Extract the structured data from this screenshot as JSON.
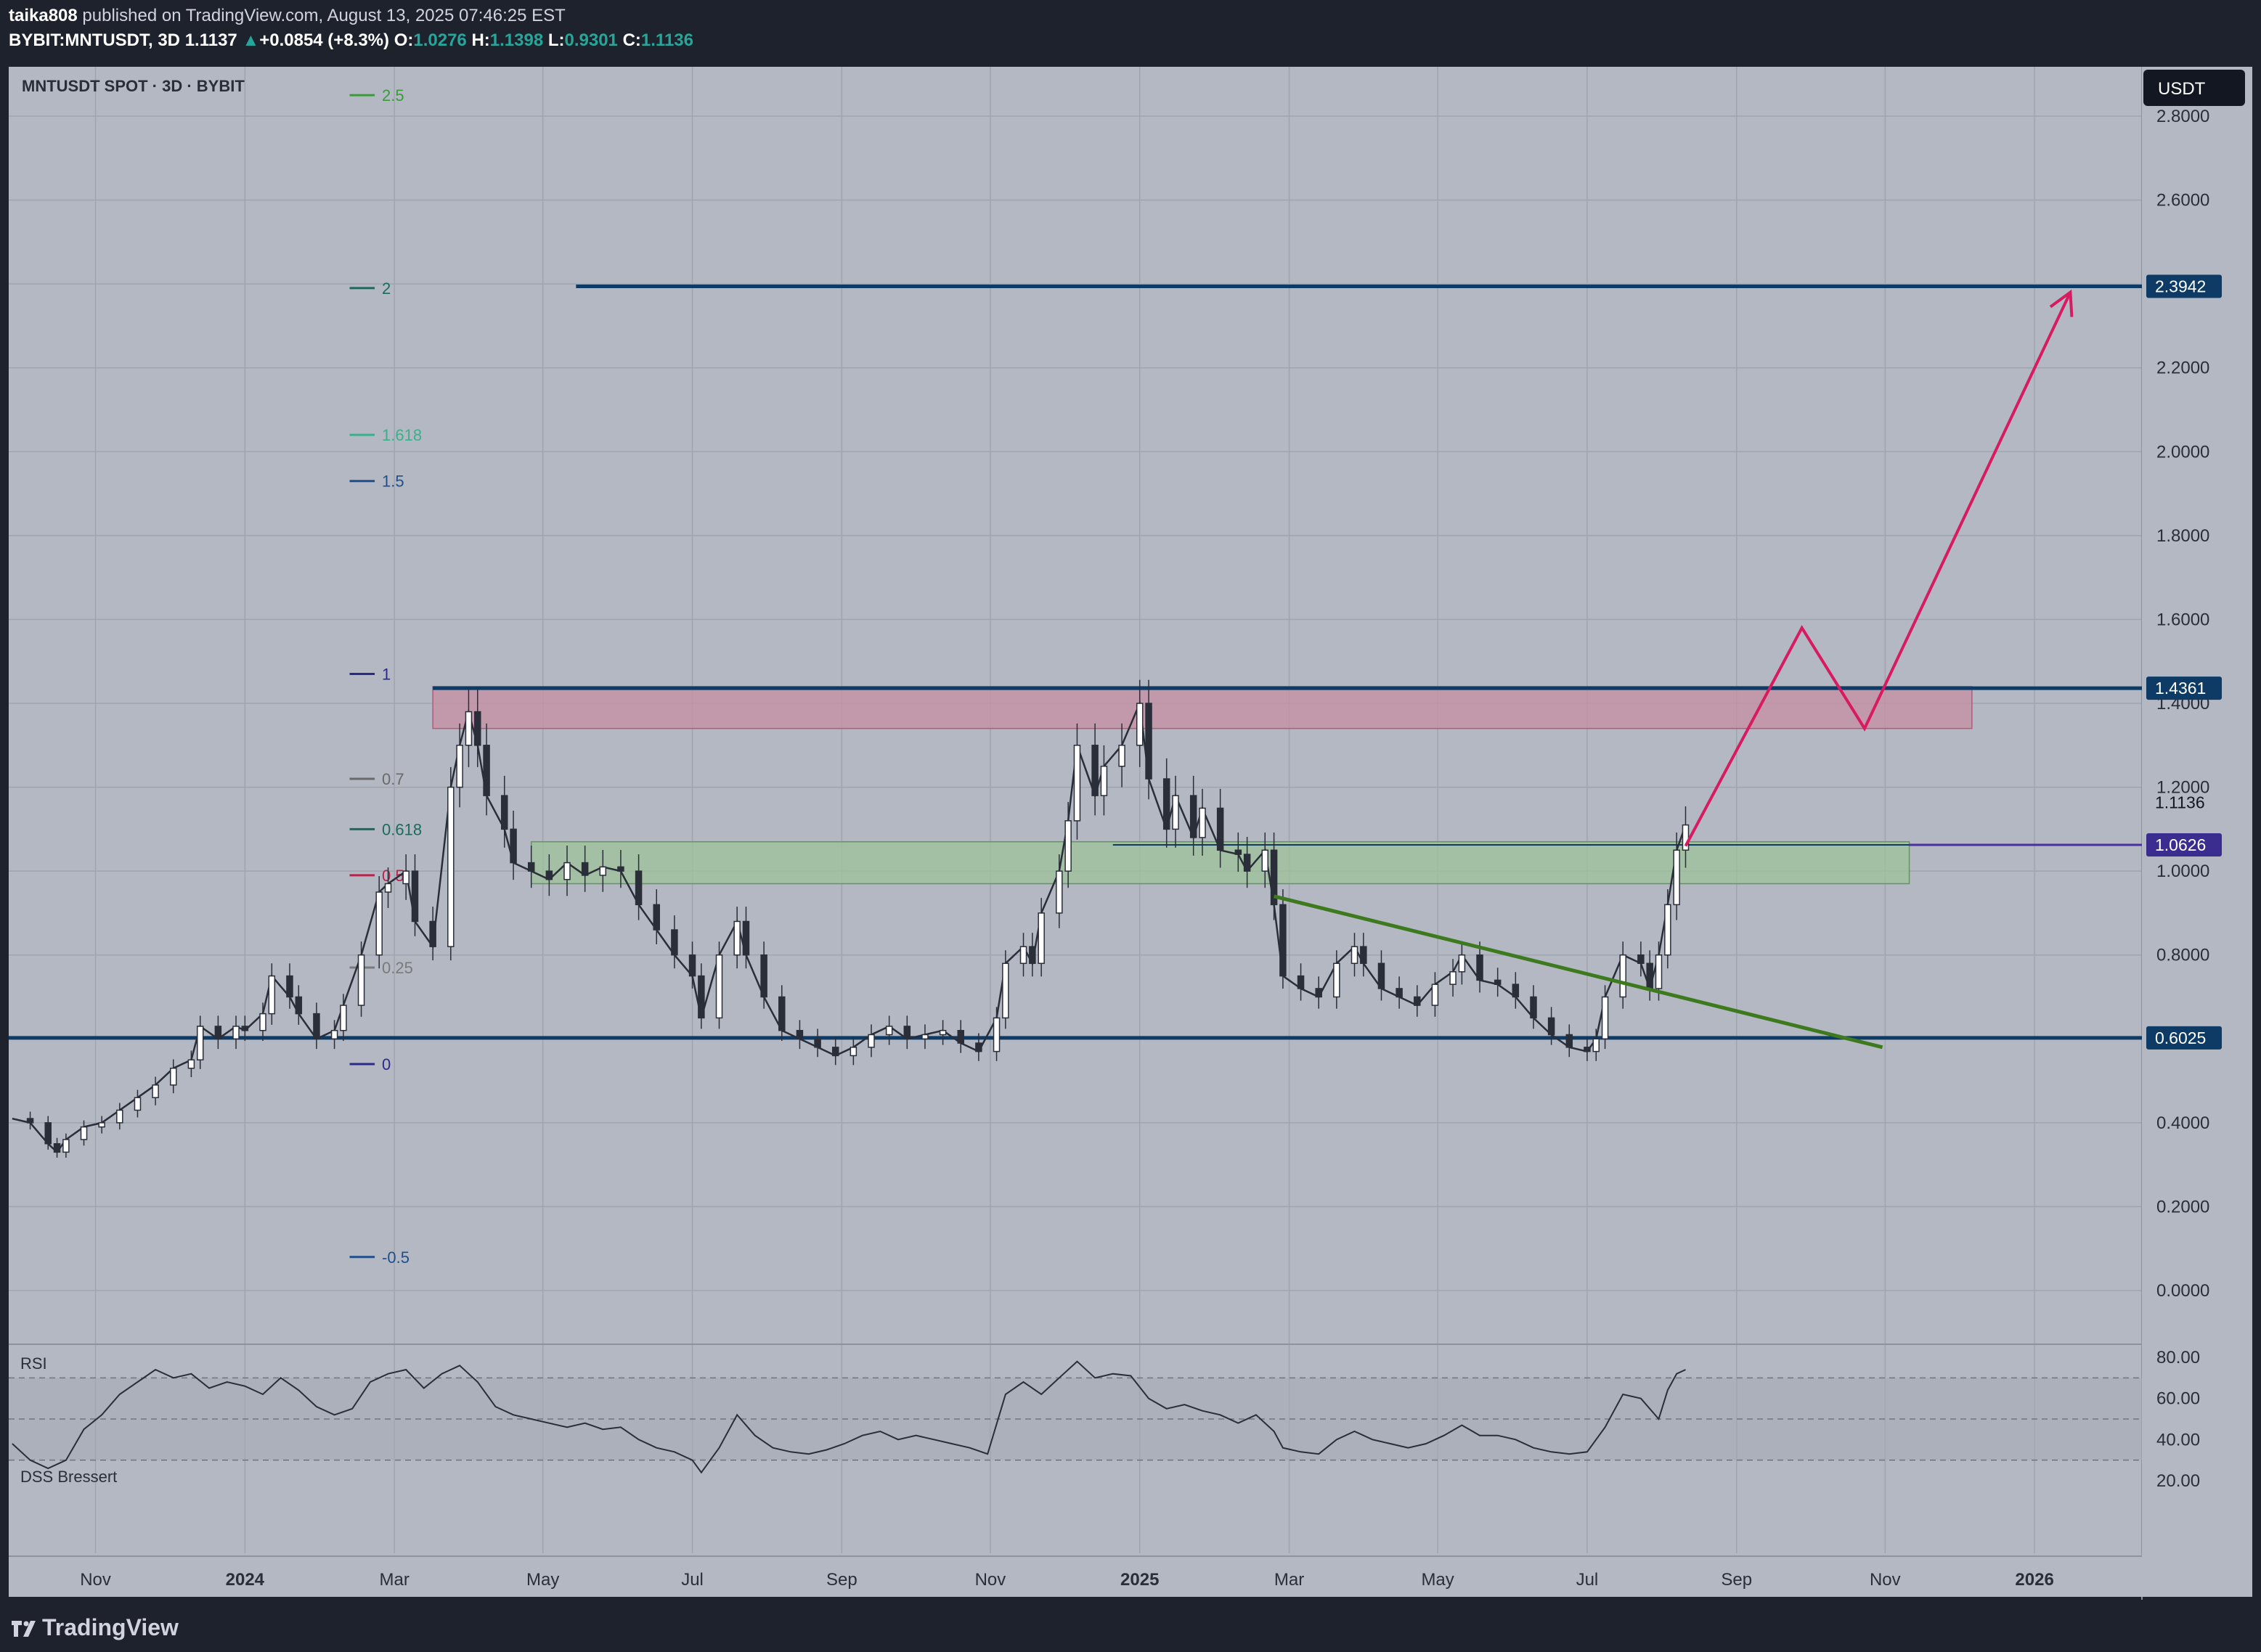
{
  "header": {
    "author": "taika808",
    "published": "published on TradingView.com, August 13, 2025 07:46:25 EST",
    "symbol": "BYBIT:MNTUSDT, 3D",
    "last": "1.1137",
    "change": "+0.0854 (+8.3%)",
    "open_label": "O:",
    "open": "1.0276",
    "high_label": "H:",
    "high": "1.1398",
    "low_label": "L:",
    "low": "0.9301",
    "close_label": "C:",
    "close": "1.1136"
  },
  "chart_title": "MNTUSDT SPOT · 3D · BYBIT",
  "currency_button": "USDT",
  "rsi_label": "RSI",
  "dss_label": "DSS Bressert",
  "footer": {
    "brand": "TradingView"
  },
  "colors": {
    "background": "#b3b8c3",
    "grid": "#9fa4ae",
    "line_navy": "#0d3b66",
    "zone_red": "#c78fa2",
    "zone_green": "#9dc19a",
    "arrow": "#d81b60",
    "trendline": "#3d7a1e",
    "axis_bg": "#b3b8c3"
  },
  "chart_data": {
    "type": "line",
    "subtype": "candlestick-approx",
    "title": "MNTUSDT SPOT · 3D · BYBIT",
    "y_axis": {
      "min": 0,
      "max": 2.8,
      "ticks": [
        "2.8000",
        "2.6000",
        "2.4000",
        "2.2000",
        "2.0000",
        "1.8000",
        "1.6000",
        "1.4000",
        "1.2000",
        "1.0000",
        "0.8000",
        "0.6000",
        "0.4000",
        "0.2000",
        "0.0000"
      ]
    },
    "x_axis": {
      "labels": [
        {
          "t": "Nov",
          "x": 2023.833
        },
        {
          "t": "2024",
          "x": 2024.0
        },
        {
          "t": "Mar",
          "x": 2024.167
        },
        {
          "t": "May",
          "x": 2024.333
        },
        {
          "t": "Jul",
          "x": 2024.5
        },
        {
          "t": "Sep",
          "x": 2024.667
        },
        {
          "t": "Nov",
          "x": 2024.833
        },
        {
          "t": "2025",
          "x": 2025.0
        },
        {
          "t": "Mar",
          "x": 2025.167
        },
        {
          "t": "May",
          "x": 2025.333
        },
        {
          "t": "Jul",
          "x": 2025.5
        },
        {
          "t": "Sep",
          "x": 2025.667
        },
        {
          "t": "Nov",
          "x": 2025.833
        },
        {
          "t": "2026",
          "x": 2026.0
        }
      ],
      "range": [
        2023.736,
        2026.12
      ]
    },
    "price_path": [
      [
        2023.74,
        0.41
      ],
      [
        2023.76,
        0.4
      ],
      [
        2023.78,
        0.35
      ],
      [
        2023.79,
        0.33
      ],
      [
        2023.8,
        0.36
      ],
      [
        2023.82,
        0.39
      ],
      [
        2023.84,
        0.4
      ],
      [
        2023.86,
        0.43
      ],
      [
        2023.88,
        0.46
      ],
      [
        2023.9,
        0.49
      ],
      [
        2023.92,
        0.53
      ],
      [
        2023.94,
        0.55
      ],
      [
        2023.95,
        0.63
      ],
      [
        2023.97,
        0.6
      ],
      [
        2023.99,
        0.63
      ],
      [
        2024.0,
        0.62
      ],
      [
        2024.02,
        0.66
      ],
      [
        2024.03,
        0.75
      ],
      [
        2024.05,
        0.7
      ],
      [
        2024.06,
        0.66
      ],
      [
        2024.08,
        0.6
      ],
      [
        2024.1,
        0.62
      ],
      [
        2024.11,
        0.68
      ],
      [
        2024.13,
        0.8
      ],
      [
        2024.15,
        0.95
      ],
      [
        2024.16,
        0.97
      ],
      [
        2024.18,
        1.0
      ],
      [
        2024.19,
        0.88
      ],
      [
        2024.21,
        0.82
      ],
      [
        2024.23,
        1.2
      ],
      [
        2024.24,
        1.3
      ],
      [
        2024.25,
        1.38
      ],
      [
        2024.26,
        1.3
      ],
      [
        2024.27,
        1.18
      ],
      [
        2024.29,
        1.1
      ],
      [
        2024.3,
        1.02
      ],
      [
        2024.32,
        1.0
      ],
      [
        2024.34,
        0.98
      ],
      [
        2024.36,
        1.02
      ],
      [
        2024.38,
        0.99
      ],
      [
        2024.4,
        1.01
      ],
      [
        2024.42,
        1.0
      ],
      [
        2024.44,
        0.92
      ],
      [
        2024.46,
        0.86
      ],
      [
        2024.48,
        0.8
      ],
      [
        2024.5,
        0.75
      ],
      [
        2024.51,
        0.65
      ],
      [
        2024.53,
        0.8
      ],
      [
        2024.55,
        0.88
      ],
      [
        2024.56,
        0.8
      ],
      [
        2024.58,
        0.7
      ],
      [
        2024.6,
        0.62
      ],
      [
        2024.62,
        0.6
      ],
      [
        2024.64,
        0.58
      ],
      [
        2024.66,
        0.56
      ],
      [
        2024.68,
        0.58
      ],
      [
        2024.7,
        0.61
      ],
      [
        2024.72,
        0.63
      ],
      [
        2024.74,
        0.6
      ],
      [
        2024.76,
        0.61
      ],
      [
        2024.78,
        0.62
      ],
      [
        2024.8,
        0.59
      ],
      [
        2024.82,
        0.57
      ],
      [
        2024.84,
        0.65
      ],
      [
        2024.85,
        0.78
      ],
      [
        2024.87,
        0.82
      ],
      [
        2024.88,
        0.78
      ],
      [
        2024.89,
        0.9
      ],
      [
        2024.91,
        1.0
      ],
      [
        2024.92,
        1.12
      ],
      [
        2024.93,
        1.3
      ],
      [
        2024.95,
        1.18
      ],
      [
        2024.96,
        1.25
      ],
      [
        2024.98,
        1.3
      ],
      [
        2025.0,
        1.4
      ],
      [
        2025.01,
        1.22
      ],
      [
        2025.03,
        1.1
      ],
      [
        2025.04,
        1.18
      ],
      [
        2025.06,
        1.08
      ],
      [
        2025.07,
        1.15
      ],
      [
        2025.09,
        1.05
      ],
      [
        2025.11,
        1.04
      ],
      [
        2025.12,
        1.0
      ],
      [
        2025.14,
        1.05
      ],
      [
        2025.15,
        0.92
      ],
      [
        2025.16,
        0.75
      ],
      [
        2025.18,
        0.72
      ],
      [
        2025.2,
        0.7
      ],
      [
        2025.22,
        0.78
      ],
      [
        2025.24,
        0.82
      ],
      [
        2025.25,
        0.78
      ],
      [
        2025.27,
        0.72
      ],
      [
        2025.29,
        0.7
      ],
      [
        2025.31,
        0.68
      ],
      [
        2025.33,
        0.73
      ],
      [
        2025.35,
        0.76
      ],
      [
        2025.36,
        0.8
      ],
      [
        2025.38,
        0.74
      ],
      [
        2025.4,
        0.73
      ],
      [
        2025.42,
        0.7
      ],
      [
        2025.44,
        0.65
      ],
      [
        2025.46,
        0.61
      ],
      [
        2025.48,
        0.58
      ],
      [
        2025.5,
        0.57
      ],
      [
        2025.51,
        0.6
      ],
      [
        2025.52,
        0.7
      ],
      [
        2025.54,
        0.8
      ],
      [
        2025.56,
        0.78
      ],
      [
        2025.57,
        0.72
      ],
      [
        2025.58,
        0.8
      ],
      [
        2025.59,
        0.92
      ],
      [
        2025.6,
        1.05
      ],
      [
        2025.61,
        1.11
      ]
    ],
    "horizontal_levels": [
      {
        "price": 2.3942,
        "x_start": 2024.37,
        "label": "2.3942",
        "color": "#0d3b66"
      },
      {
        "price": 1.4361,
        "x_start": 2024.21,
        "label": "1.4361",
        "color": "#0d3b66"
      },
      {
        "price": 1.0626,
        "x_start": 2024.97,
        "label": "1.0626",
        "color": "#0d3b66"
      },
      {
        "price": 0.6025,
        "x_start": 2023.736,
        "label": "0.6025",
        "color": "#0d3b66"
      }
    ],
    "current_price": "1.1136",
    "zones": [
      {
        "color": "red",
        "x0": 2024.21,
        "x1": 2025.93,
        "y0": 1.34,
        "y1": 1.44
      },
      {
        "color": "green",
        "x0": 2024.32,
        "x1": 2025.86,
        "y0": 0.97,
        "y1": 1.07
      }
    ],
    "trendline": [
      [
        2025.15,
        0.94
      ],
      [
        2025.83,
        0.58
      ]
    ],
    "projection_arrow": [
      [
        2025.61,
        1.06
      ],
      [
        2025.74,
        1.58
      ],
      [
        2025.81,
        1.34
      ],
      [
        2026.04,
        2.38
      ]
    ],
    "fibonacci": [
      {
        "level": "2.5",
        "price": 2.85,
        "color": "#3c9a3c"
      },
      {
        "level": "2",
        "price": 2.39,
        "color": "#1a6b5c"
      },
      {
        "level": "1.618",
        "price": 2.04,
        "color": "#3ab08a"
      },
      {
        "level": "1.5",
        "price": 1.93,
        "color": "#1f4f8a"
      },
      {
        "level": "1",
        "price": 1.47,
        "color": "#2a2a8a"
      },
      {
        "level": "0.7",
        "price": 1.22,
        "color": "#6a6a6a"
      },
      {
        "level": "0.618",
        "price": 1.1,
        "color": "#1a6b5c"
      },
      {
        "level": "0.5",
        "price": 0.99,
        "color": "#b8234a"
      },
      {
        "level": "0.25",
        "price": 0.77,
        "color": "#7a7a7a"
      },
      {
        "level": "0",
        "price": 0.54,
        "color": "#2a2a8a"
      },
      {
        "level": "-0.5",
        "price": 0.08,
        "color": "#1f4f8a"
      }
    ],
    "rsi": {
      "ticks": [
        "80.00",
        "60.00",
        "40.00",
        "20.00"
      ],
      "band_upper": 70,
      "band_lower": 30,
      "values": [
        [
          2023.74,
          38
        ],
        [
          2023.76,
          30
        ],
        [
          2023.78,
          26
        ],
        [
          2023.8,
          30
        ],
        [
          2023.82,
          45
        ],
        [
          2023.84,
          52
        ],
        [
          2023.86,
          62
        ],
        [
          2023.88,
          68
        ],
        [
          2023.9,
          74
        ],
        [
          2023.92,
          70
        ],
        [
          2023.94,
          72
        ],
        [
          2023.96,
          65
        ],
        [
          2023.98,
          68
        ],
        [
          2024.0,
          66
        ],
        [
          2024.02,
          62
        ],
        [
          2024.04,
          70
        ],
        [
          2024.06,
          64
        ],
        [
          2024.08,
          56
        ],
        [
          2024.1,
          52
        ],
        [
          2024.12,
          55
        ],
        [
          2024.14,
          68
        ],
        [
          2024.16,
          72
        ],
        [
          2024.18,
          74
        ],
        [
          2024.2,
          65
        ],
        [
          2024.22,
          72
        ],
        [
          2024.24,
          76
        ],
        [
          2024.26,
          68
        ],
        [
          2024.28,
          56
        ],
        [
          2024.3,
          52
        ],
        [
          2024.32,
          50
        ],
        [
          2024.34,
          48
        ],
        [
          2024.36,
          46
        ],
        [
          2024.38,
          48
        ],
        [
          2024.4,
          45
        ],
        [
          2024.42,
          46
        ],
        [
          2024.44,
          40
        ],
        [
          2024.46,
          36
        ],
        [
          2024.48,
          34
        ],
        [
          2024.5,
          30
        ],
        [
          2024.51,
          24
        ],
        [
          2024.53,
          36
        ],
        [
          2024.55,
          52
        ],
        [
          2024.57,
          42
        ],
        [
          2024.59,
          36
        ],
        [
          2024.61,
          34
        ],
        [
          2024.63,
          33
        ],
        [
          2024.65,
          35
        ],
        [
          2024.67,
          38
        ],
        [
          2024.69,
          42
        ],
        [
          2024.71,
          44
        ],
        [
          2024.73,
          40
        ],
        [
          2024.75,
          42
        ],
        [
          2024.77,
          40
        ],
        [
          2024.79,
          38
        ],
        [
          2024.81,
          36
        ],
        [
          2024.83,
          33
        ],
        [
          2024.85,
          62
        ],
        [
          2024.87,
          68
        ],
        [
          2024.89,
          62
        ],
        [
          2024.91,
          70
        ],
        [
          2024.93,
          78
        ],
        [
          2024.95,
          70
        ],
        [
          2024.97,
          72
        ],
        [
          2024.99,
          71
        ],
        [
          2025.01,
          60
        ],
        [
          2025.03,
          55
        ],
        [
          2025.05,
          57
        ],
        [
          2025.07,
          54
        ],
        [
          2025.09,
          52
        ],
        [
          2025.11,
          48
        ],
        [
          2025.13,
          52
        ],
        [
          2025.15,
          44
        ],
        [
          2025.16,
          36
        ],
        [
          2025.18,
          34
        ],
        [
          2025.2,
          33
        ],
        [
          2025.22,
          40
        ],
        [
          2025.24,
          44
        ],
        [
          2025.26,
          40
        ],
        [
          2025.28,
          38
        ],
        [
          2025.3,
          36
        ],
        [
          2025.32,
          38
        ],
        [
          2025.34,
          42
        ],
        [
          2025.36,
          47
        ],
        [
          2025.38,
          42
        ],
        [
          2025.4,
          42
        ],
        [
          2025.42,
          40
        ],
        [
          2025.44,
          36
        ],
        [
          2025.46,
          34
        ],
        [
          2025.48,
          33
        ],
        [
          2025.5,
          34
        ],
        [
          2025.52,
          46
        ],
        [
          2025.54,
          62
        ],
        [
          2025.56,
          60
        ],
        [
          2025.58,
          50
        ],
        [
          2025.59,
          64
        ],
        [
          2025.6,
          72
        ],
        [
          2025.61,
          74
        ]
      ]
    }
  }
}
